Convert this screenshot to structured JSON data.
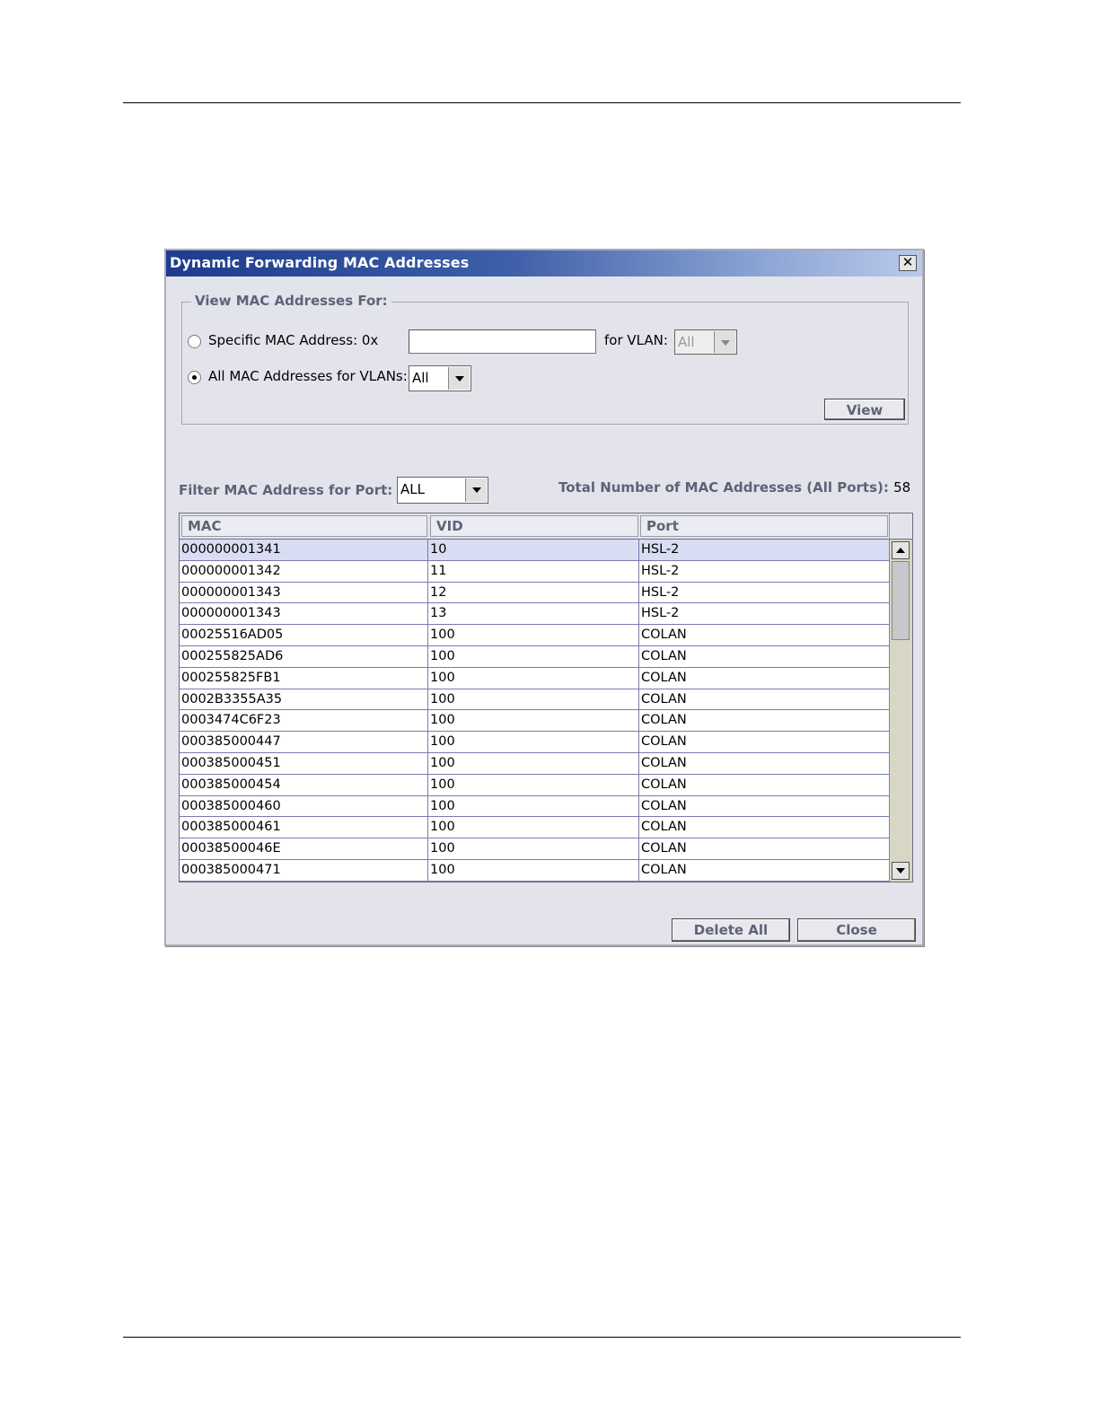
{
  "dialog": {
    "title": "Dynamic Forwarding MAC Addresses",
    "close_glyph": "✕"
  },
  "view_group": {
    "legend": "View MAC Addresses For:",
    "specific_label": "Specific MAC Address: 0x",
    "specific_value": "",
    "vlan_label": "for VLAN:",
    "vlan_value": "All",
    "all_label": "All MAC Addresses for VLANs:",
    "all_vlan_value": "All",
    "selected": "all",
    "view_button": "View"
  },
  "filter": {
    "label": "Filter MAC Address for Port:",
    "value": "ALL",
    "total_label": "Total Number of MAC Addresses (All Ports):",
    "total_value": "58"
  },
  "table": {
    "columns": [
      "MAC",
      "VID",
      "Port"
    ],
    "rows": [
      [
        "000000001341",
        "10",
        "HSL-2"
      ],
      [
        "000000001342",
        "11",
        "HSL-2"
      ],
      [
        "000000001343",
        "12",
        "HSL-2"
      ],
      [
        "000000001343",
        "13",
        "HSL-2"
      ],
      [
        "00025516AD05",
        "100",
        "COLAN"
      ],
      [
        "000255825AD6",
        "100",
        "COLAN"
      ],
      [
        "000255825FB1",
        "100",
        "COLAN"
      ],
      [
        "0002B3355A35",
        "100",
        "COLAN"
      ],
      [
        "0003474C6F23",
        "100",
        "COLAN"
      ],
      [
        "000385000447",
        "100",
        "COLAN"
      ],
      [
        "000385000451",
        "100",
        "COLAN"
      ],
      [
        "000385000454",
        "100",
        "COLAN"
      ],
      [
        "000385000460",
        "100",
        "COLAN"
      ],
      [
        "000385000461",
        "100",
        "COLAN"
      ],
      [
        "00038500046E",
        "100",
        "COLAN"
      ],
      [
        "000385000471",
        "100",
        "COLAN"
      ]
    ],
    "selected_row": 0
  },
  "buttons": {
    "delete_all": "Delete All",
    "close": "Close"
  },
  "colors": {
    "title_gradient_start": "#1d3c8c",
    "title_gradient_end": "#b9c9ea",
    "dialog_bg": "#e3e3ec",
    "label_bold": "#5e6376",
    "selected_row": "#d9ddf3"
  },
  "icons": {
    "close": "close-icon",
    "dropdown": "chevron-down-icon",
    "scroll_up": "arrow-up-icon",
    "scroll_down": "arrow-down-icon"
  }
}
